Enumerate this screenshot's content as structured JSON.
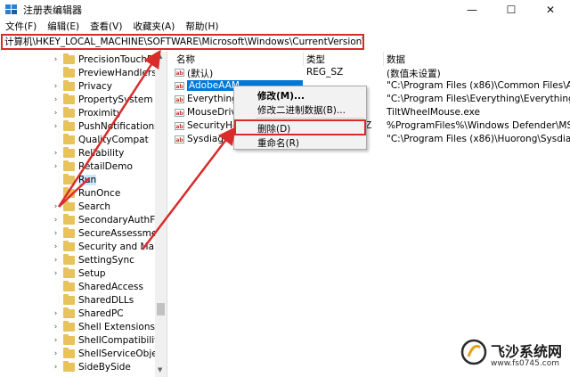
{
  "window": {
    "title": "注册表编辑器",
    "minimize_icon": "minimize-icon",
    "maximize_icon": "maximize-icon",
    "close_icon": "close-icon"
  },
  "menu": [
    "文件(F)",
    "编辑(E)",
    "查看(V)",
    "收藏夹(A)",
    "帮助(H)"
  ],
  "address": "计算机\\HKEY_LOCAL_MACHINE\\SOFTWARE\\Microsoft\\Windows\\CurrentVersion\\Run",
  "tree": {
    "items": [
      {
        "label": "PrecisionTouchPad",
        "expandable": true
      },
      {
        "label": "PreviewHandlers",
        "expandable": false
      },
      {
        "label": "Privacy",
        "expandable": true
      },
      {
        "label": "PropertySystem",
        "expandable": true
      },
      {
        "label": "Proximity",
        "expandable": true
      },
      {
        "label": "PushNotifications",
        "expandable": true
      },
      {
        "label": "QualityCompat",
        "expandable": false
      },
      {
        "label": "Reliability",
        "expandable": true
      },
      {
        "label": "RetailDemo",
        "expandable": true
      },
      {
        "label": "Run",
        "expandable": false,
        "selected": true
      },
      {
        "label": "RunOnce",
        "expandable": false
      },
      {
        "label": "Search",
        "expandable": true
      },
      {
        "label": "SecondaryAuthFactor",
        "expandable": true
      },
      {
        "label": "SecureAssessment",
        "expandable": true
      },
      {
        "label": "Security and Mainten",
        "expandable": true
      },
      {
        "label": "SettingSync",
        "expandable": true
      },
      {
        "label": "Setup",
        "expandable": true
      },
      {
        "label": "SharedAccess",
        "expandable": false
      },
      {
        "label": "SharedDLLs",
        "expandable": false
      },
      {
        "label": "SharedPC",
        "expandable": true
      },
      {
        "label": "Shell Extensions",
        "expandable": true
      },
      {
        "label": "ShellCompatibility",
        "expandable": true
      },
      {
        "label": "ShellServiceObjectDe",
        "expandable": true
      },
      {
        "label": "SideBySide",
        "expandable": true
      }
    ]
  },
  "columns": {
    "name": "名称",
    "type": "类型",
    "data": "数据"
  },
  "values": [
    {
      "name": "(默认)",
      "type": "REG_SZ",
      "data": "(数值未设置)",
      "selected": false
    },
    {
      "name": "AdobeAAM",
      "type": "",
      "data": "\"C:\\Program Files (x86)\\Common Files\\Adobe\\",
      "selected": true
    },
    {
      "name": "Everything",
      "type": "",
      "data": "\"C:\\Program Files\\Everything\\Everything.exe\" -s",
      "selected": false
    },
    {
      "name": "MouseDrive",
      "type": "",
      "data": "TiltWheelMouse.exe",
      "selected": false
    },
    {
      "name": "SecurityHea",
      "type": "Z",
      "data": "%ProgramFiles%\\Windows Defender\\MSASCui",
      "selected": false
    },
    {
      "name": "Sysdiag",
      "type": "",
      "data": "\"C:\\Program Files (x86)\\Huorong\\Sysdiag\\bin\\",
      "selected": false
    }
  ],
  "context_menu": {
    "items": [
      "修改(M)...",
      "修改二进制数据(B)...",
      "删除(D)",
      "重命名(R)"
    ]
  },
  "value_icon_text": "ab",
  "watermark": {
    "title": "飞沙系统网",
    "url": "www.fs0745.com"
  },
  "colors": {
    "highlight_red": "#d92b2b",
    "selection_blue": "#0078d7",
    "folder": "#e8c25a"
  }
}
